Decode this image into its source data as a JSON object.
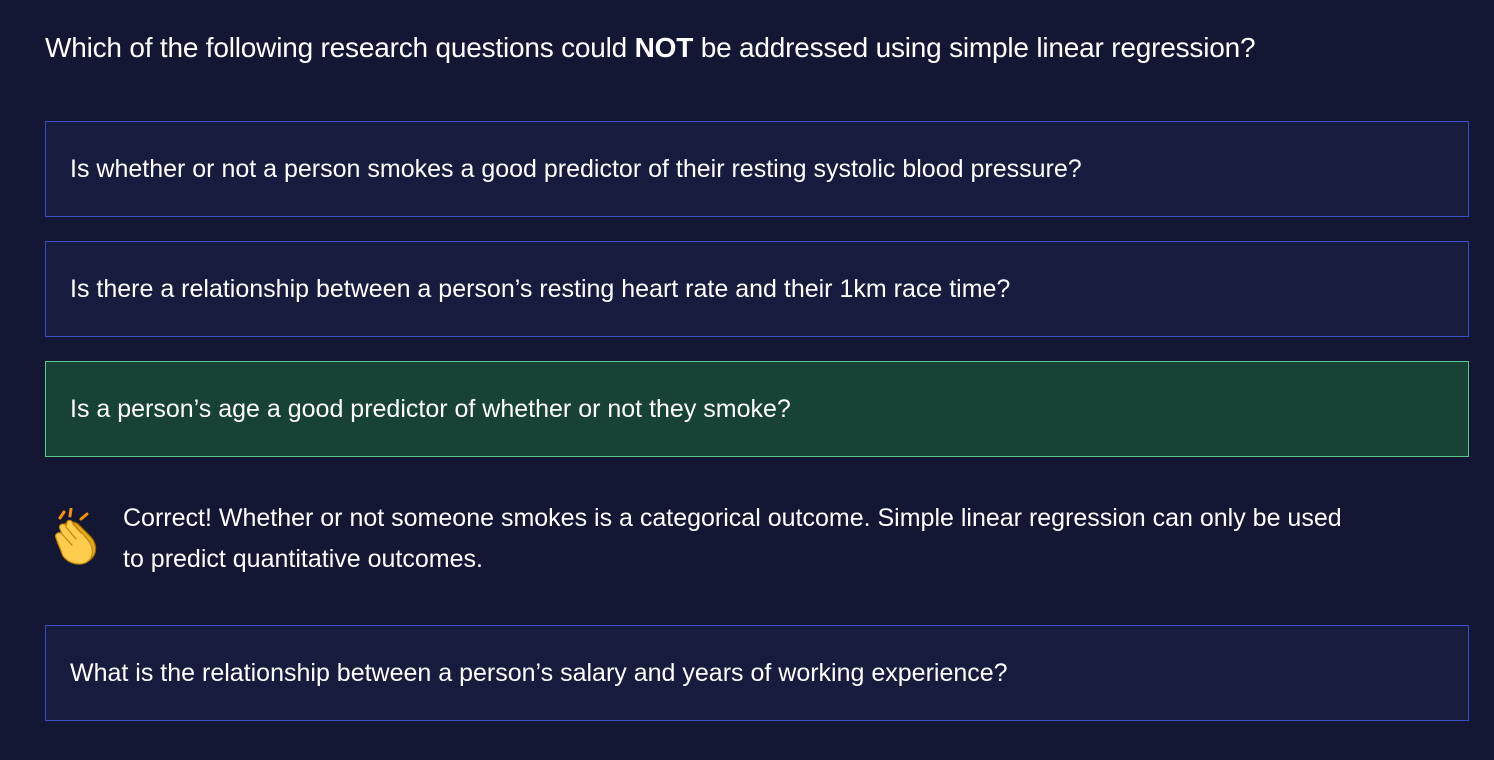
{
  "question": {
    "before": "Which of the following research questions could ",
    "emphasis": "NOT",
    "after": " be addressed using simple linear regression?"
  },
  "options": [
    {
      "label": "Is whether or not a person smokes a good predictor of their resting systolic blood pressure?",
      "state": "default"
    },
    {
      "label": "Is there a relationship between a person’s resting heart rate and their 1km race time?",
      "state": "default"
    },
    {
      "label": "Is a person’s age a good predictor of whether or not they smoke?",
      "state": "correct"
    },
    {
      "label": "What is the relationship between a person’s salary and years of working experience?",
      "state": "default"
    }
  ],
  "feedback": {
    "icon": "clapping-hands-icon",
    "text": "Correct! Whether or not someone smokes is a categorical outcome. Simple linear regression can only be used to predict quantitative outcomes."
  },
  "colors": {
    "background": "#131733",
    "option_background": "#171c3f",
    "option_border": "#3b4fc4",
    "correct_background": "#184235",
    "correct_border": "#56c98a"
  }
}
